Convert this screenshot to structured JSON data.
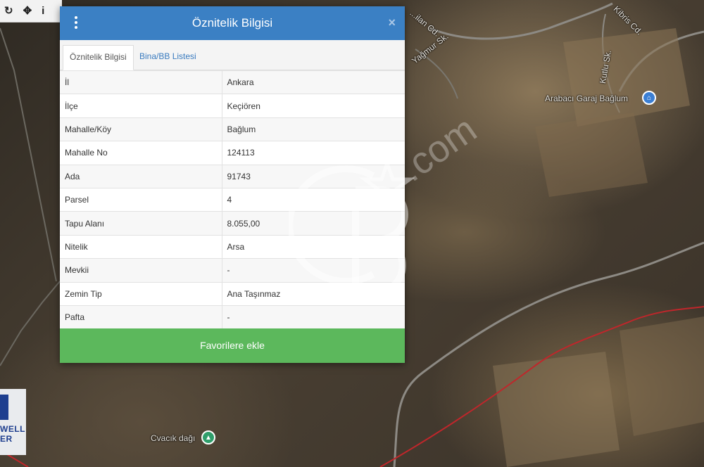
{
  "toolbar": {
    "tools": [
      {
        "icon": "refresh-icon",
        "glyph": "↻"
      },
      {
        "icon": "move-icon",
        "glyph": "✥"
      },
      {
        "icon": "info-icon",
        "glyph": "i"
      }
    ]
  },
  "map": {
    "labels": {
      "street1": "Yağmur Sk.",
      "street2": "Kibris Cd.",
      "street3": "Kutlu Sk.",
      "street4": "...ilan Cd.",
      "poi1": "Arabacı Garaj Bağlum",
      "poi2": "Cvacık dağı"
    },
    "colors": {
      "boundary": "#c0262b",
      "poi_blue": "#3b7fd4",
      "poi_green": "#2f9e6b"
    }
  },
  "brand_card": {
    "line1": "WELL",
    "line2": "ER"
  },
  "dialog": {
    "title": "Öznitelik Bilgisi",
    "close_glyph": "×",
    "tabs": [
      {
        "label": "Öznitelik Bilgisi",
        "active": true
      },
      {
        "label": "Bina/BB Listesi",
        "active": false
      }
    ],
    "rows": [
      {
        "key": "İl",
        "value": "Ankara"
      },
      {
        "key": "İlçe",
        "value": "Keçiören"
      },
      {
        "key": "Mahalle/Köy",
        "value": "Bağlum"
      },
      {
        "key": "Mahalle No",
        "value": "124113"
      },
      {
        "key": "Ada",
        "value": "91743"
      },
      {
        "key": "Parsel",
        "value": "4"
      },
      {
        "key": "Tapu Alanı",
        "value": "8.055,00"
      },
      {
        "key": "Nitelik",
        "value": "Arsa"
      },
      {
        "key": "Mevkii",
        "value": "-"
      },
      {
        "key": "Zemin Tip",
        "value": "Ana Taşınmaz"
      },
      {
        "key": "Pafta",
        "value": "-"
      }
    ],
    "favorite_button": "Favorilere ekle",
    "header_color": "#3b80c4",
    "button_color": "#5cb85c"
  },
  "watermark": {
    "text": ".com"
  }
}
